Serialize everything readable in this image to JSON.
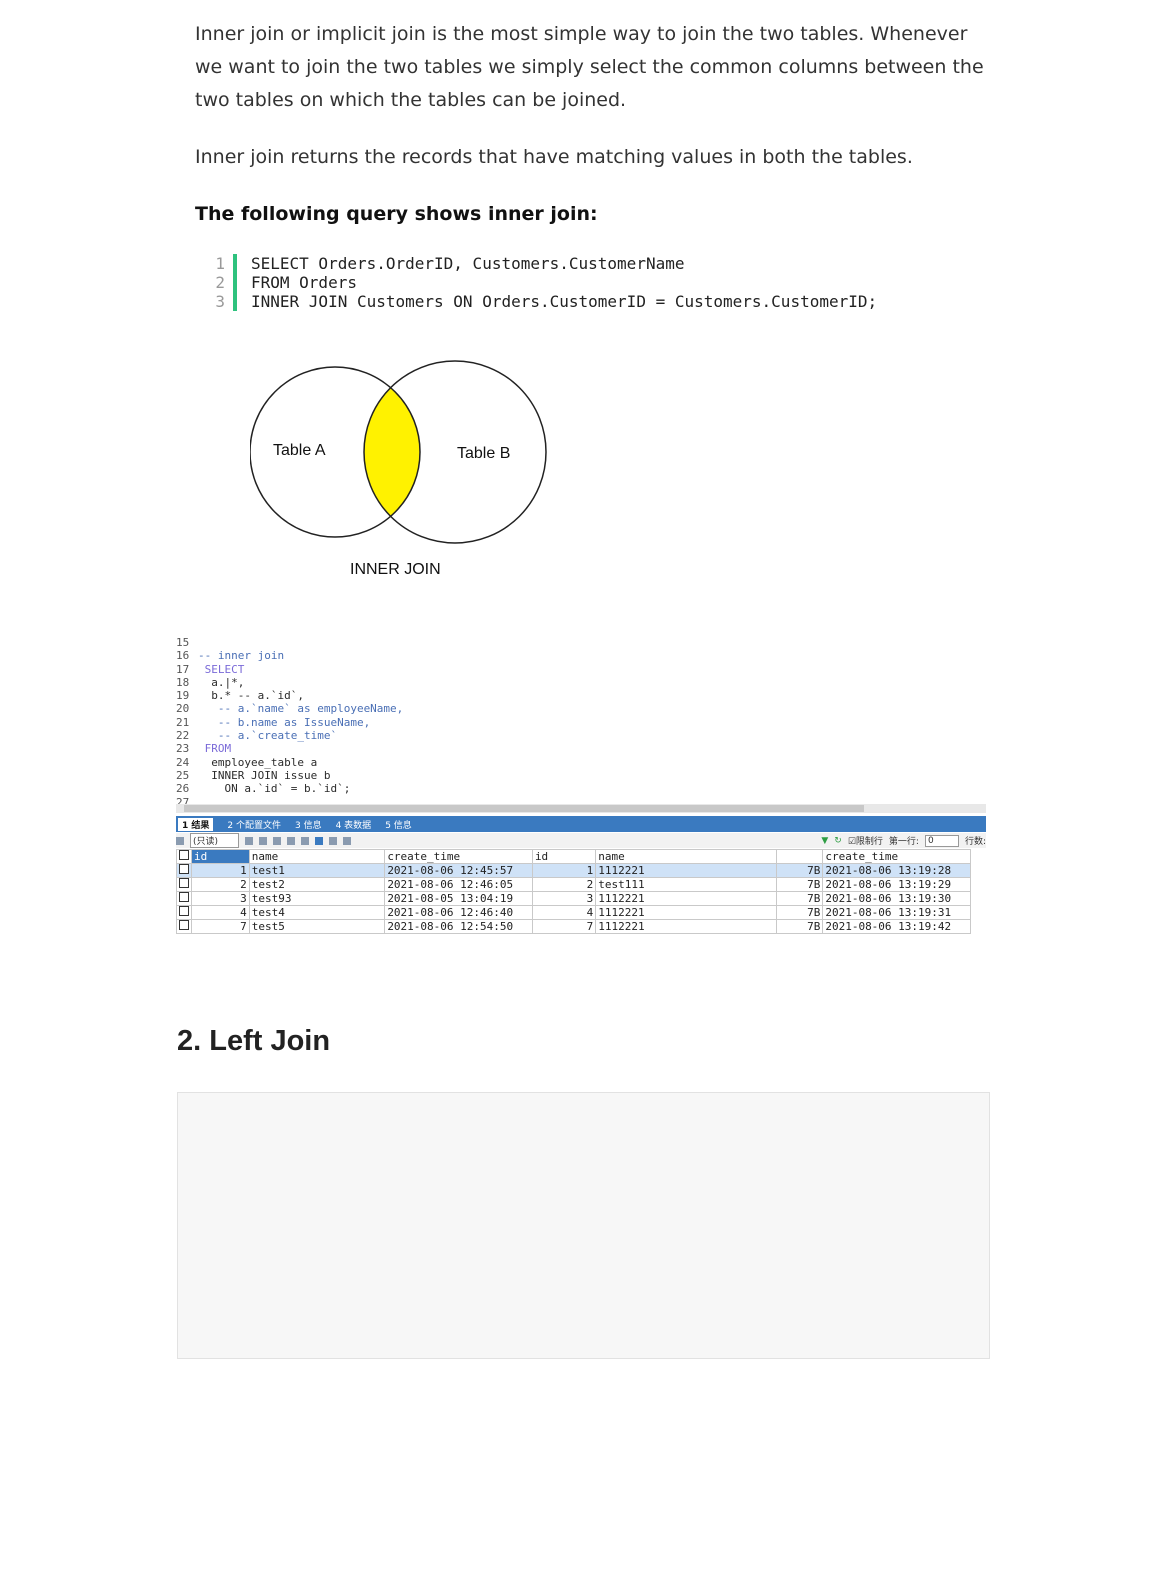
{
  "intro": {
    "para1": "Inner join or implicit join is the most simple way to join the two tables. Whenever we want to join the two tables we simply select the common columns between the two tables on which the tables can be joined.",
    "para2": "Inner join returns the records that have matching values in both the tables.",
    "query_heading": "The following query shows inner join:"
  },
  "code_block": {
    "lines": [
      {
        "num": "1",
        "text": "SELECT Orders.OrderID, Customers.CustomerName"
      },
      {
        "num": "2",
        "text": "FROM Orders"
      },
      {
        "num": "3",
        "text": "INNER JOIN Customers ON Orders.CustomerID = Customers.CustomerID;"
      }
    ]
  },
  "venn": {
    "left_label": "Table A",
    "right_label": "Table B",
    "caption": "INNER JOIN",
    "highlight_color": "#fff200"
  },
  "editor": {
    "lines": [
      {
        "num": "15",
        "text": ""
      },
      {
        "num": "16",
        "text": "-- inner join"
      },
      {
        "num": "17",
        "text": " SELECT"
      },
      {
        "num": "18",
        "text": "  a.|*,"
      },
      {
        "num": "19",
        "text": "  b.* -- a.`id`,"
      },
      {
        "num": "20",
        "text": "   -- a.`name` as employeeName,"
      },
      {
        "num": "21",
        "text": "   -- b.name as IssueName,"
      },
      {
        "num": "22",
        "text": "   -- a.`create_time`"
      },
      {
        "num": "23",
        "text": " FROM"
      },
      {
        "num": "24",
        "text": "  employee_table a"
      },
      {
        "num": "25",
        "text": "  INNER JOIN issue b"
      },
      {
        "num": "26",
        "text": "    ON a.`id` = b.`id`;"
      },
      {
        "num": "27",
        "text": ""
      }
    ]
  },
  "result_tabs": [
    "1 结果",
    "2 个配置文件",
    "3 信息",
    "4 表数据",
    "5 信息"
  ],
  "result_toolbar": {
    "mode": "(只读)",
    "limit_label": "限制行",
    "first_row_label": "第一行:",
    "first_row_value": "0",
    "rows_label": "行数:"
  },
  "result_grid": {
    "headers": [
      "id",
      "name",
      "create_time",
      "id",
      "name",
      "",
      "create_time"
    ],
    "rows": [
      [
        "1",
        "test1",
        "2021-08-06 12:45:57",
        "1",
        "1112221",
        "7B",
        "2021-08-06 13:19:28"
      ],
      [
        "2",
        "test2",
        "2021-08-06 12:46:05",
        "2",
        "test111",
        "7B",
        "2021-08-06 13:19:29"
      ],
      [
        "3",
        "test93",
        "2021-08-05 13:04:19",
        "3",
        "1112221",
        "7B",
        "2021-08-06 13:19:30"
      ],
      [
        "4",
        "test4",
        "2021-08-06 12:46:40",
        "4",
        "1112221",
        "7B",
        "2021-08-06 13:19:31"
      ],
      [
        "7",
        "test5",
        "2021-08-06 12:54:50",
        "7",
        "1112221",
        "7B",
        "2021-08-06 13:19:42"
      ]
    ]
  },
  "section2": {
    "title": "2. Left Join"
  }
}
